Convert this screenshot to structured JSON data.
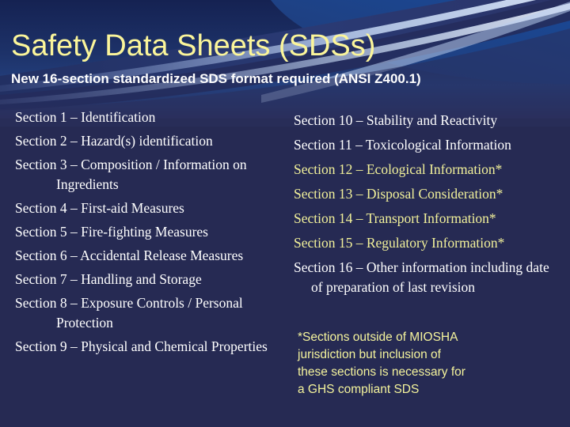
{
  "slide": {
    "title": "Safety Data Sheets (SDSs)",
    "subtitle": "New 16-section standardized SDS format required (ANSI Z400.1)",
    "colors": {
      "background": "#262a53",
      "title_text": "#fbf59a",
      "subtitle_text": "#ffffff",
      "body_text": "#ffffff",
      "starred_text": "#f2f19a",
      "footnote_text": "#f4f39c",
      "accent_blue": "#1c4fa0"
    }
  },
  "left_column": [
    {
      "text": "Section 1 – Identification",
      "starred": false
    },
    {
      "text": "Section 2 – Hazard(s) identification",
      "starred": false
    },
    {
      "text": "Section 3 – Composition / Information on Ingredients",
      "starred": false
    },
    {
      "text": "Section 4 – First-aid Measures",
      "starred": false
    },
    {
      "text": "Section 5 – Fire-fighting Measures",
      "starred": false
    },
    {
      "text": "Section 6 – Accidental Release Measures",
      "starred": false
    },
    {
      "text": "Section 7 – Handling and Storage",
      "starred": false
    },
    {
      "text": "Section 8 – Exposure Controls / Personal Protection",
      "starred": false
    },
    {
      "text": "Section 9 – Physical and Chemical Properties",
      "starred": false
    }
  ],
  "right_column": [
    {
      "text": "Section 10 – Stability and Reactivity",
      "starred": false
    },
    {
      "text": "Section 11 – Toxicological Information",
      "starred": false
    },
    {
      "text": "Section 12 – Ecological Information*",
      "starred": true
    },
    {
      "text": "Section 13 – Disposal Consideration*",
      "starred": true
    },
    {
      "text": "Section 14 – Transport Information*",
      "starred": true
    },
    {
      "text": "Section 15 – Regulatory Information*",
      "starred": true
    },
    {
      "text": "Section 16 – Other information including date of preparation of last revision",
      "starred": false
    }
  ],
  "footnote": {
    "lines": [
      "*Sections outside of MIOSHA",
      "jurisdiction but inclusion of",
      "these sections is necessary for",
      "a GHS compliant SDS"
    ]
  }
}
